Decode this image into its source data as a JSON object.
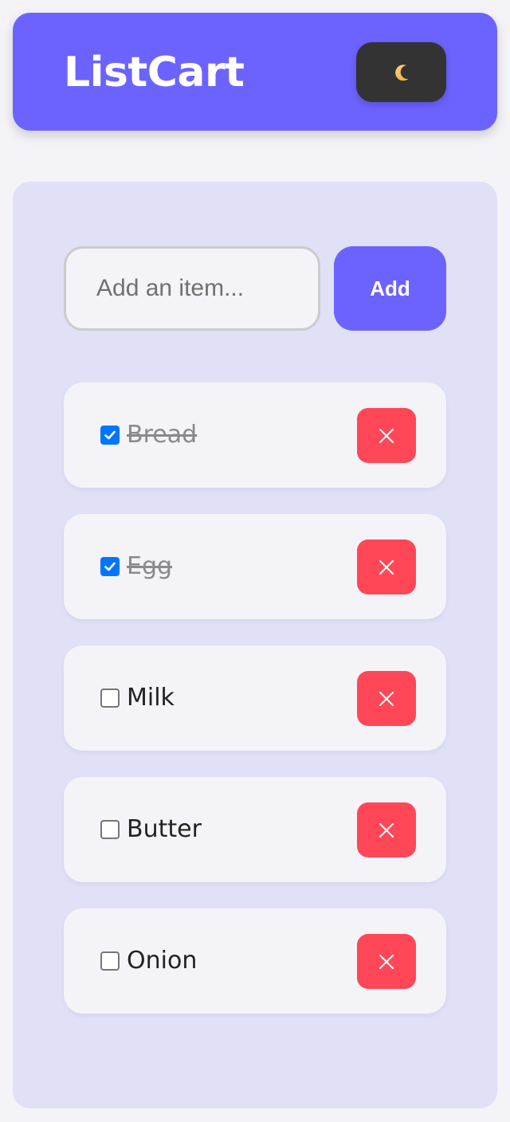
{
  "header": {
    "title": "ListCart",
    "theme_toggle": {
      "icon": "moon-icon"
    }
  },
  "add_form": {
    "placeholder": "Add an item...",
    "value": "",
    "add_label": "Add"
  },
  "items": [
    {
      "label": "Bread",
      "checked": true
    },
    {
      "label": "Egg",
      "checked": true
    },
    {
      "label": "Milk",
      "checked": false
    },
    {
      "label": "Butter",
      "checked": false
    },
    {
      "label": "Onion",
      "checked": false
    }
  ],
  "colors": {
    "primary": "#6c63ff",
    "panel": "#e0e0f7",
    "background": "#f4f4f8",
    "danger": "#ff4757",
    "toggle": "#333333",
    "checkbox_checked": "#0075ff"
  }
}
